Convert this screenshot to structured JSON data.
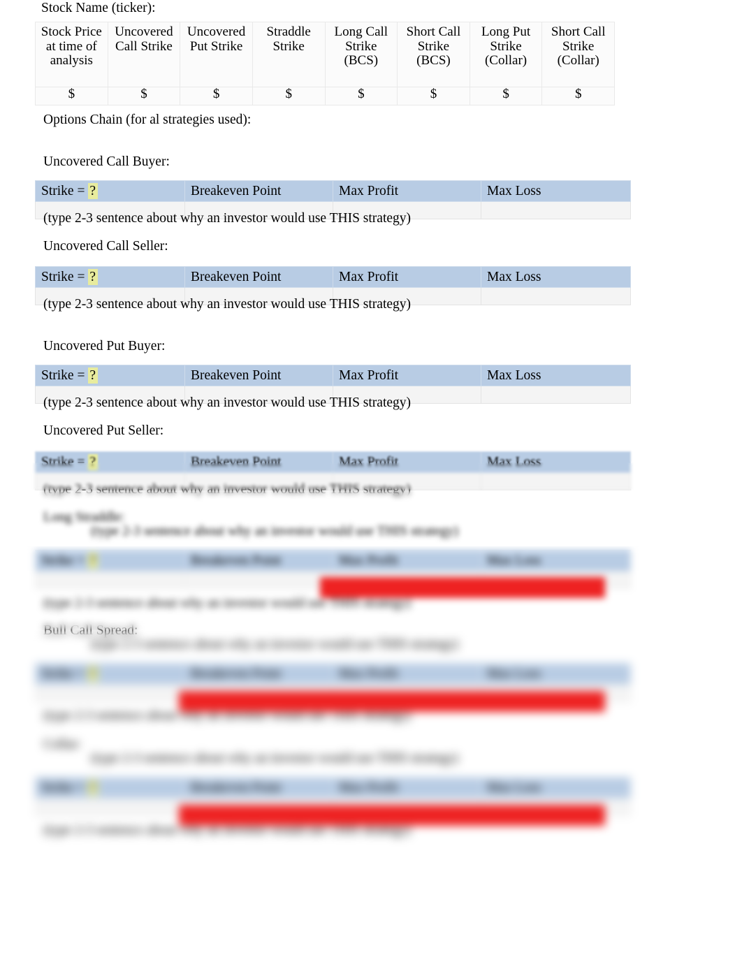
{
  "document": {
    "stock_name_label": "Stock Name (ticker):",
    "options_chain_label": "Options Chain (for al strategies used):"
  },
  "strike_table": {
    "headers": [
      "Stock Price at time of analysis",
      "Uncovered Call Strike",
      "Uncovered Put Strike",
      "Straddle Strike",
      "Long Call Strike (BCS)",
      "Short Call Strike (BCS)",
      "Long Put Strike (Collar)",
      "Short Call Strike (Collar)"
    ],
    "values": [
      "$",
      "$",
      "$",
      "$",
      "$",
      "$",
      "$",
      "$"
    ]
  },
  "strategy_table_headers": {
    "strike_label": "Strike = ",
    "strike_value": "?",
    "breakeven": "Breakeven Point",
    "max_profit": "Max Profit",
    "max_loss": "Max Loss"
  },
  "prompt_text": "(type 2-3 sentence about why an investor would use THIS strategy)",
  "sections": [
    {
      "title": "Uncovered Call Buyer:"
    },
    {
      "title": "Uncovered Call Seller:"
    },
    {
      "title": "Uncovered Put Buyer:"
    },
    {
      "title": "Uncovered Put Seller:"
    },
    {
      "title": "Long Straddle:"
    },
    {
      "title": "Bull Call Spread:"
    },
    {
      "title": "Collar:"
    }
  ],
  "colors": {
    "header_blue": "#b8cce4",
    "highlight_yellow": "#e8ec9e",
    "redaction_red": "#ee2222",
    "body_gray": "#f4f4f4"
  }
}
